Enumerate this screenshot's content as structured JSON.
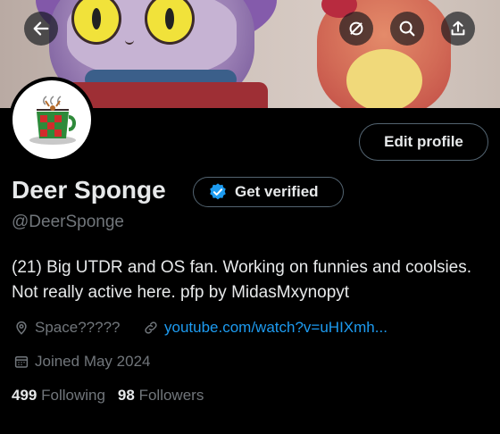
{
  "profile": {
    "name": "Deer Sponge",
    "handle": "@DeerSponge",
    "bio": "(21) Big UTDR and OS fan. Working on funnies and coolsies. Not really active here. pfp by MidasMxynopyt",
    "location": "Space?????",
    "link": "youtube.com/watch?v=uHIXmh...",
    "joined": "Joined May 2024",
    "following_count": "499",
    "following_label": "Following",
    "followers_count": "98",
    "followers_label": "Followers"
  },
  "actions": {
    "edit_profile": "Edit profile",
    "get_verified": "Get verified"
  },
  "icons": {
    "back": "back-arrow-icon",
    "mute": "mute-icon",
    "search": "search-icon",
    "share": "share-icon",
    "verified": "verified-badge-icon",
    "location": "location-pin-icon",
    "link": "link-icon",
    "calendar": "calendar-icon"
  },
  "colors": {
    "background": "#000000",
    "text": "#e7e9ea",
    "muted": "#71767b",
    "accent": "#1d9bf0",
    "border": "#536471"
  }
}
